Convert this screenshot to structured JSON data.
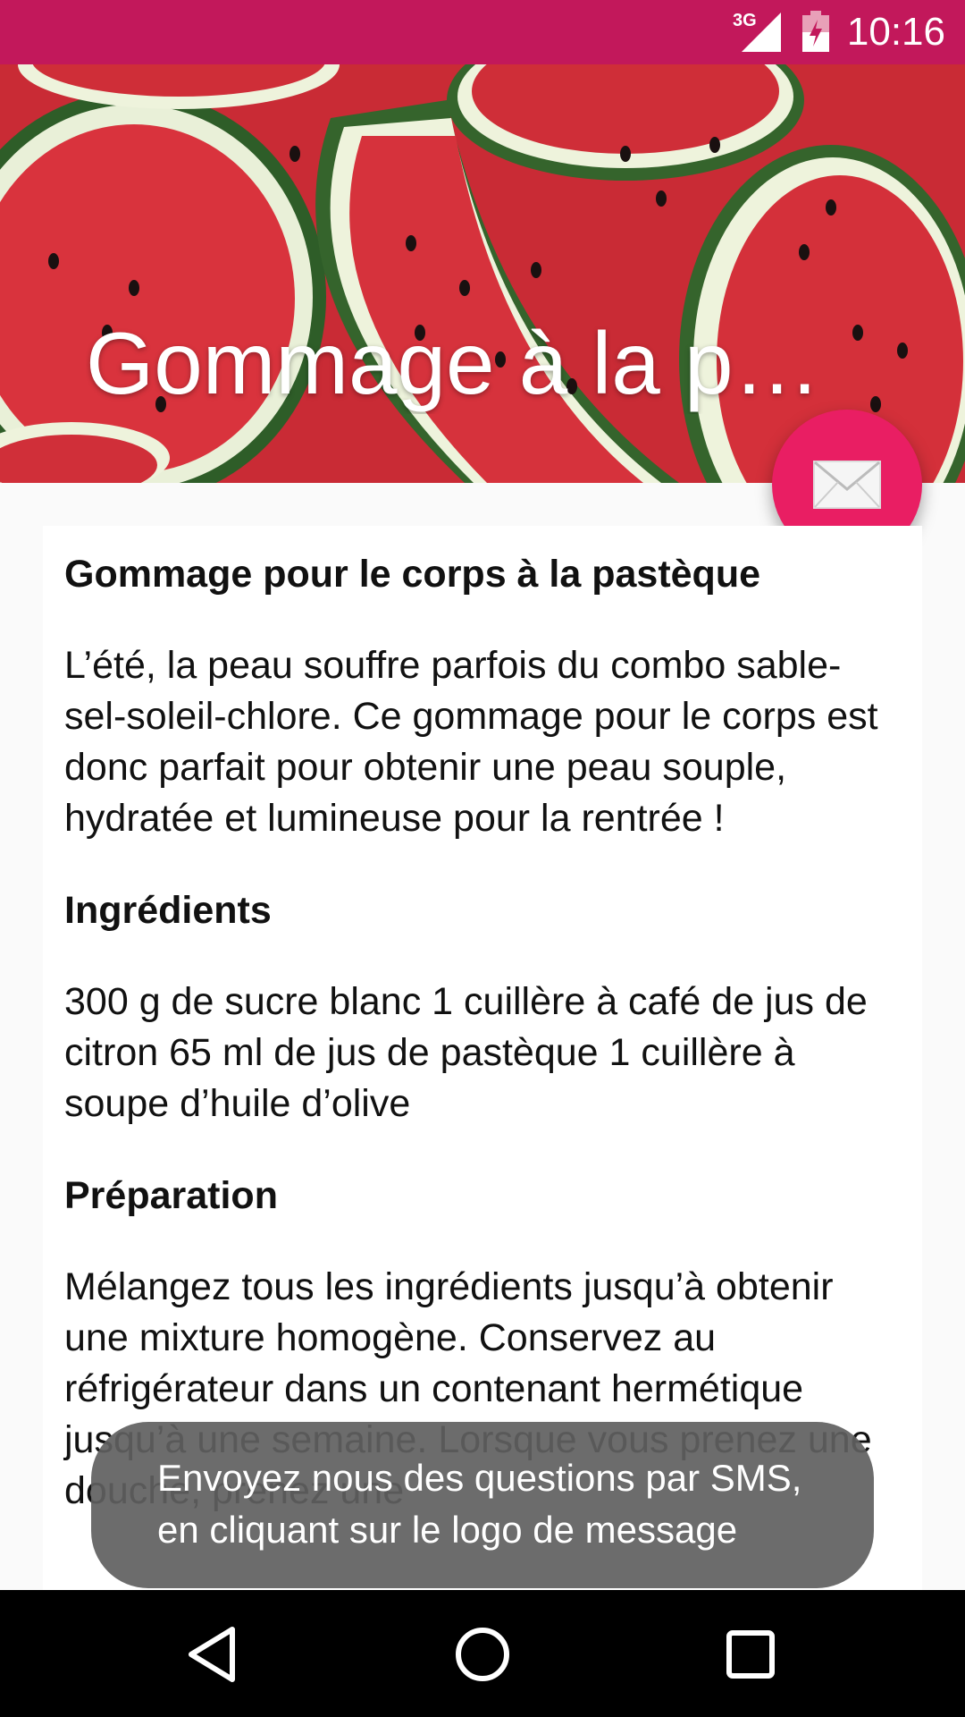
{
  "status_bar": {
    "network": "3G",
    "time": "10:16",
    "background": "#c2185b"
  },
  "header": {
    "title": "Gommage à la pa…",
    "image": "watermelon-slices"
  },
  "fab": {
    "icon": "envelope-icon",
    "color": "#e91e63"
  },
  "content": {
    "heading": "Gommage pour le corps à la pastèque",
    "intro": "L’été, la peau souffre parfois du combo sable-sel-soleil-chlore. Ce gommage pour le corps est donc parfait pour obtenir une peau souple, hydratée et lumineuse pour la rentrée !",
    "ingredients_heading": "Ingrédients",
    "ingredients_text": "300 g de sucre blanc 1 cuillère à café de jus de citron 65 ml de jus de pastèque 1 cuillère à soupe d’huile d’olive",
    "preparation_heading": "Préparation",
    "preparation_text": "Mélangez tous les ingrédients jusqu’à obtenir une mixture homogène. Conservez au réfrigérateur dans un contenant hermétique jusqu’à une semaine. Lorsque vous prenez une douche, prenez une"
  },
  "toast": {
    "line1": "Envoyez nous des questions par SMS,",
    "line2": "en cliquant sur le logo de message"
  },
  "nav_bar": {
    "back_icon": "back-triangle-icon",
    "home_icon": "home-circle-icon",
    "recents_icon": "recents-square-icon"
  }
}
